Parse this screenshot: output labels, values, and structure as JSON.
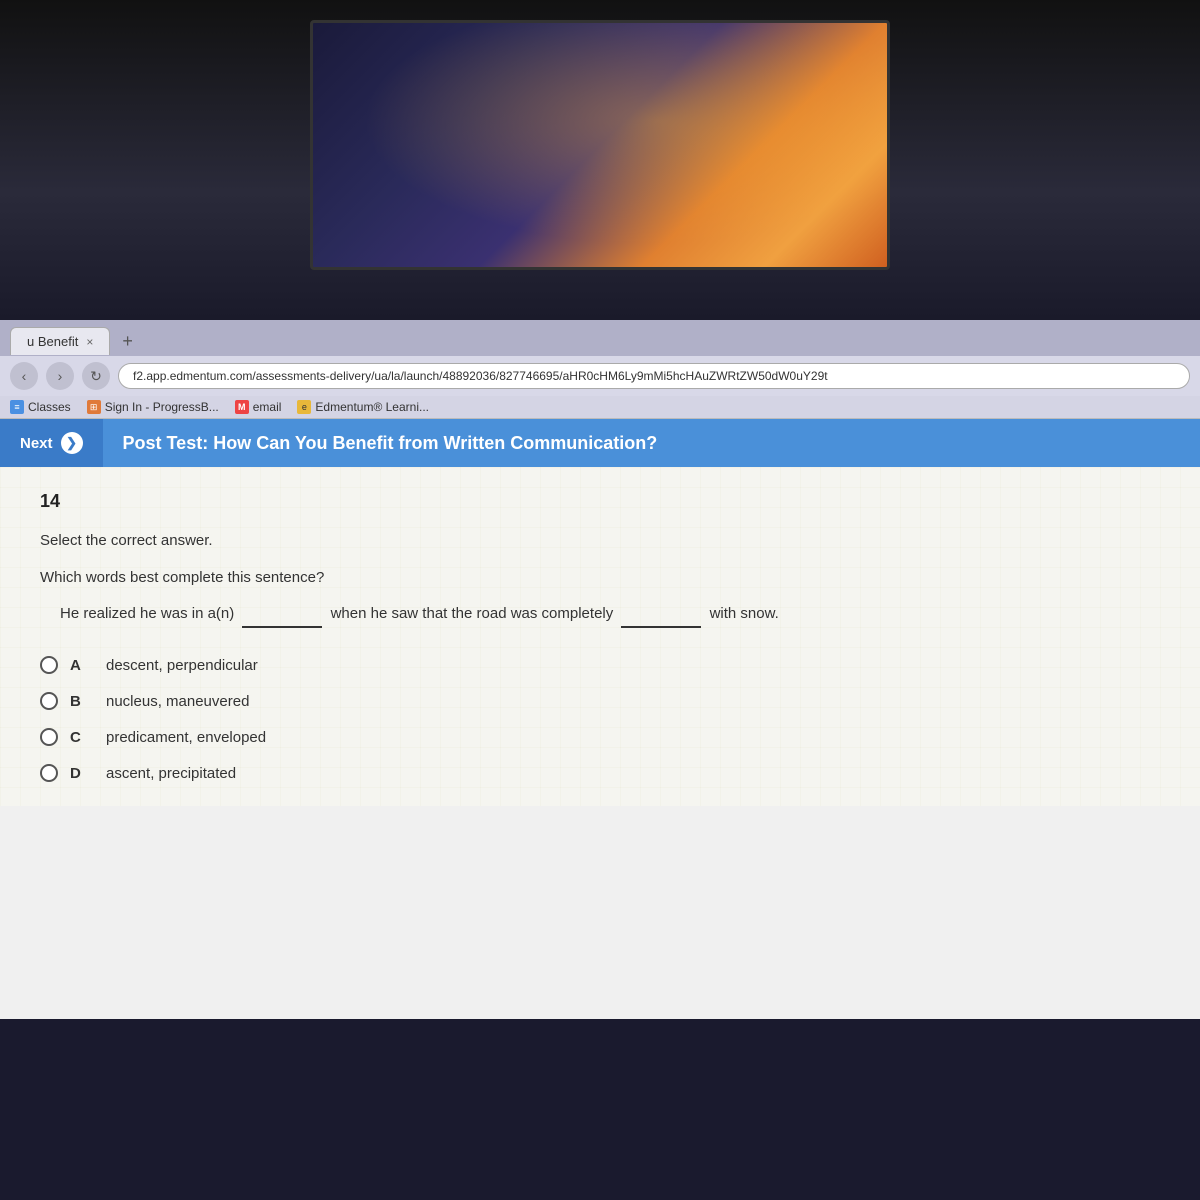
{
  "camera": {
    "visible": true
  },
  "browser": {
    "tab_label": "u Benefit",
    "tab_close": "×",
    "tab_new": "+",
    "address": "f2.app.edmentum.com/assessments-delivery/ua/la/launch/48892036/827746695/aHR0cHM6Ly9mMi5hcHAuZWRtZW50dW0uY29t",
    "bookmarks": [
      {
        "id": "classes",
        "label": "Classes",
        "icon": "≡",
        "icon_class": "bk-classes"
      },
      {
        "id": "progress",
        "label": "Sign In - ProgressB...",
        "icon": "⊞",
        "icon_class": "bk-progress"
      },
      {
        "id": "email",
        "label": "email",
        "icon": "M",
        "icon_class": "bk-email"
      },
      {
        "id": "edmentum",
        "label": "Edmentum® Learni...",
        "icon": "e",
        "icon_class": "bk-edmentum"
      }
    ]
  },
  "top_bar": {
    "next_label": "Next",
    "next_icon": "❯",
    "page_title": "Post Test: How Can You Benefit from Written Communication?"
  },
  "question": {
    "number": "14",
    "instruction": "Select the correct answer.",
    "question_text": "Which words best complete this sentence?",
    "sentence": "He realized he was in a(n) ________ when he saw that the road was completely ________ with snow.",
    "options": [
      {
        "id": "A",
        "text": "descent, perpendicular"
      },
      {
        "id": "B",
        "text": "nucleus, maneuvered"
      },
      {
        "id": "C",
        "text": "predicament, enveloped"
      },
      {
        "id": "D",
        "text": "ascent, precipitated"
      }
    ]
  }
}
